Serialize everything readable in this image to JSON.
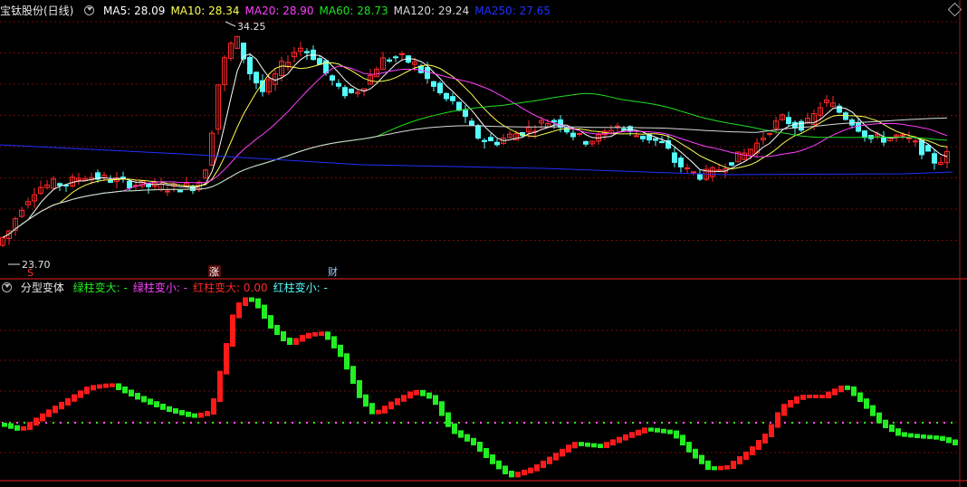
{
  "colors": {
    "background": "#000000",
    "grid": "#7a0a0a",
    "separator": "#a01818",
    "up": "#ff2a2a",
    "down": "#54fcfc",
    "ma5": "#ffffff",
    "ma10": "#ffff50",
    "ma20": "#ff40ff",
    "ma60": "#20e020",
    "ma120": "#d8d8d8",
    "ma250": "#2030ff",
    "ind_red": "#ff1a1a",
    "ind_green": "#22ee22",
    "ind_dots": "#ff55ff"
  },
  "header_top": {
    "title": "宝钛股份(日线)",
    "indicators": [
      {
        "label": "MA5: 28.09",
        "color": "#ffffff"
      },
      {
        "label": "MA10: 28.34",
        "color": "#ffff50"
      },
      {
        "label": "MA20: 28.90",
        "color": "#ff40ff"
      },
      {
        "label": "MA60: 28.73",
        "color": "#20e020"
      },
      {
        "label": "MA120: 29.24",
        "color": "#d8d8d8"
      },
      {
        "label": "MA250: 27.65",
        "color": "#2030ff"
      }
    ]
  },
  "header_bottom": {
    "title": "分型变体",
    "items": [
      {
        "label": "绿柱变大: -",
        "color": "#22ee22"
      },
      {
        "label": "绿柱变小: -",
        "color": "#ff40ff"
      },
      {
        "label": "红柱变大: 0.00",
        "color": "#ff2a2a"
      },
      {
        "label": "红柱变小: -",
        "color": "#54fcfc"
      }
    ]
  },
  "markers": {
    "high_label": "34.25",
    "low_label": "23.70",
    "event_s": "S",
    "event_zhang": "涨",
    "event_cai": "财"
  },
  "chart_data": [
    {
      "type": "candlestick",
      "title": "宝钛股份(日线)",
      "ylim": [
        23.0,
        34.8
      ],
      "annotations": [
        {
          "label": "34.25",
          "value": 34.25
        },
        {
          "label": "23.70",
          "value": 23.7
        }
      ],
      "ma_series": [
        {
          "name": "MA5",
          "value": 28.09
        },
        {
          "name": "MA10",
          "value": 28.34
        },
        {
          "name": "MA20",
          "value": 28.9
        },
        {
          "name": "MA60",
          "value": 28.73
        },
        {
          "name": "MA120",
          "value": 29.24
        },
        {
          "name": "MA250",
          "value": 27.65
        }
      ]
    },
    {
      "type": "bar",
      "title": "分型变体",
      "series": [
        {
          "name": "绿柱变大",
          "values": []
        },
        {
          "name": "绿柱变小",
          "values": []
        },
        {
          "name": "红柱变大",
          "values": [
            0.0
          ]
        },
        {
          "name": "红柱变小",
          "values": []
        }
      ]
    }
  ]
}
